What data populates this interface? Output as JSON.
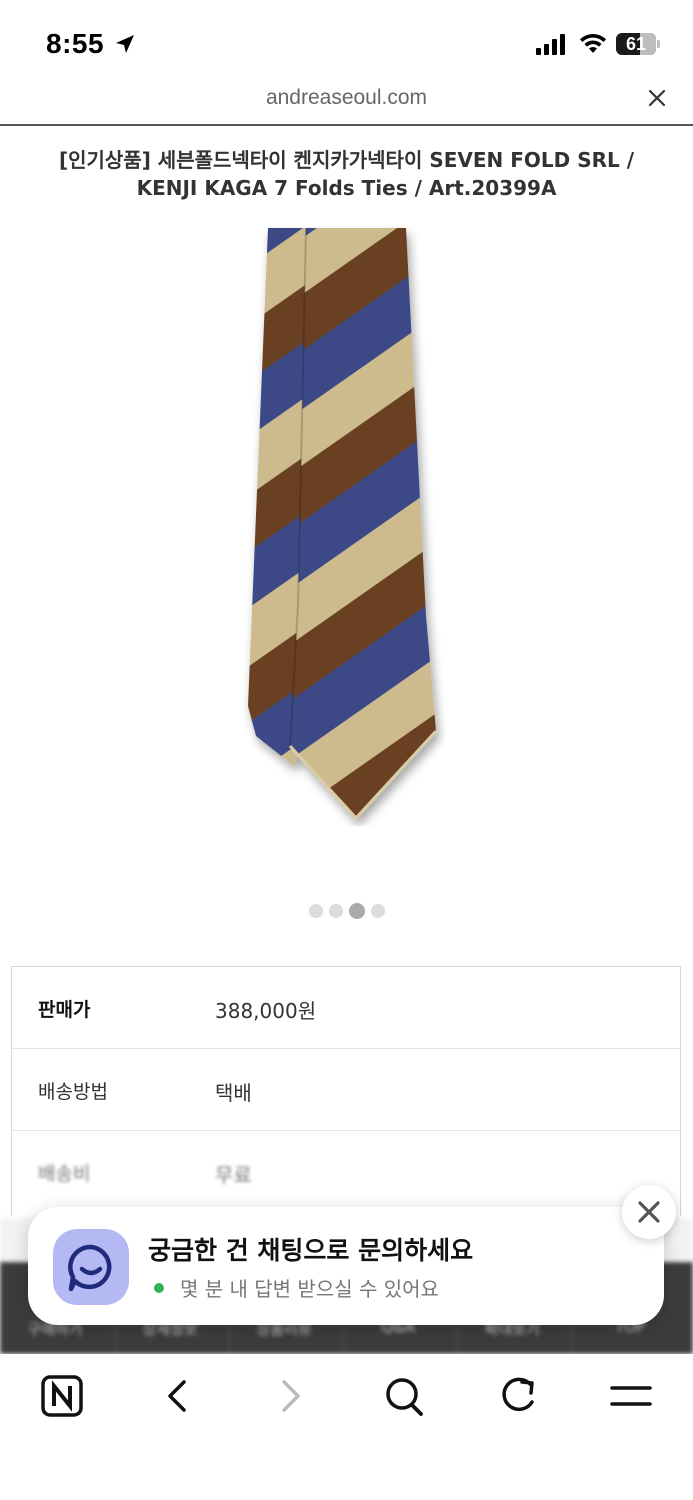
{
  "status_bar": {
    "time": "8:55",
    "battery": "61",
    "battery_level": 0.61
  },
  "browser": {
    "url": "andreaseoul.com"
  },
  "product": {
    "title_line1": "[인기상품] 세븐폴드넥타이 켄지카가넥타이 SEVEN FOLD SRL /",
    "title_line2": "KENJI KAGA 7 Folds Ties / Art.20399A",
    "image_count": 4,
    "active_image": 3
  },
  "info": {
    "rows": [
      {
        "label": "판매가",
        "value": "388,000원"
      },
      {
        "label": "배송방법",
        "value": "택배"
      },
      {
        "label": "배송비",
        "value": "무료"
      }
    ]
  },
  "tabs": [
    "구매하기",
    "상세정보",
    "상품리뷰",
    "Q&A",
    "확대보기",
    "TOP"
  ],
  "chat": {
    "title": "궁금한 건 채팅으로 문의하세요",
    "subtitle": "몇 분 내 답변 받으실 수 있어요"
  },
  "bottom_nav": {
    "icons": [
      "naver-icon",
      "back-icon",
      "forward-icon",
      "search-icon",
      "refresh-icon",
      "menu-icon"
    ]
  },
  "colors": {
    "tie_navy": "#3d4a86",
    "tie_brown": "#6b4124",
    "tie_beige": "#cdbb8e",
    "chat_avatar": "#b4b8f3",
    "online": "#2fb35a"
  }
}
